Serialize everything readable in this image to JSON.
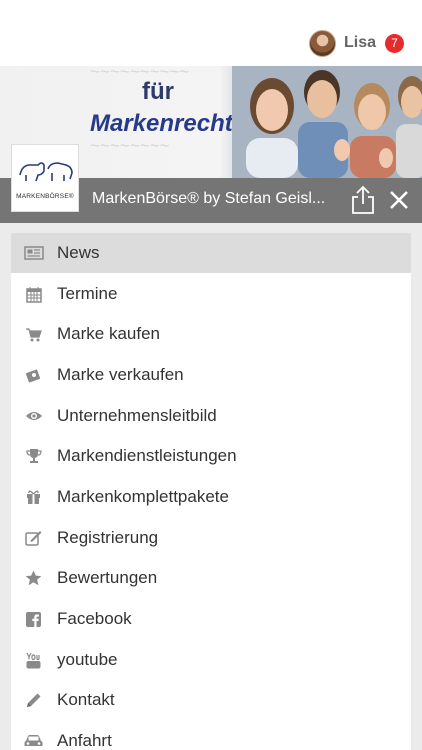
{
  "user": {
    "name": "Lisa",
    "badge_count": "7"
  },
  "banner": {
    "headline_line1": "für",
    "headline_line2": "Markenrechte"
  },
  "logo": {
    "text": "MARKENBÖRSE®"
  },
  "titlebar": {
    "title": "MarkenBörse® by Stefan Geisl..."
  },
  "menu": {
    "items": [
      {
        "label": "News",
        "icon": "newspaper-icon",
        "active": true
      },
      {
        "label": "Termine",
        "icon": "calendar-icon"
      },
      {
        "label": "Marke kaufen",
        "icon": "shopping-cart-icon"
      },
      {
        "label": "Marke verkaufen",
        "icon": "money-icon"
      },
      {
        "label": "Unternehmensleitbild",
        "icon": "eye-icon"
      },
      {
        "label": "Markendienstleistungen",
        "icon": "trophy-icon"
      },
      {
        "label": "Markenkomplettpakete",
        "icon": "gift-icon"
      },
      {
        "label": "Registrierung",
        "icon": "edit-icon"
      },
      {
        "label": "Bewertungen",
        "icon": "star-icon"
      },
      {
        "label": "Facebook",
        "icon": "facebook-icon"
      },
      {
        "label": "youtube",
        "icon": "youtube-icon"
      },
      {
        "label": "Kontakt",
        "icon": "pencil-icon"
      },
      {
        "label": "Anfahrt",
        "icon": "car-icon"
      }
    ]
  },
  "colors": {
    "titlebar": "#757575",
    "badge": "#e52b2b",
    "active_item": "#dcdcdc",
    "icon": "#8a8a8a"
  }
}
